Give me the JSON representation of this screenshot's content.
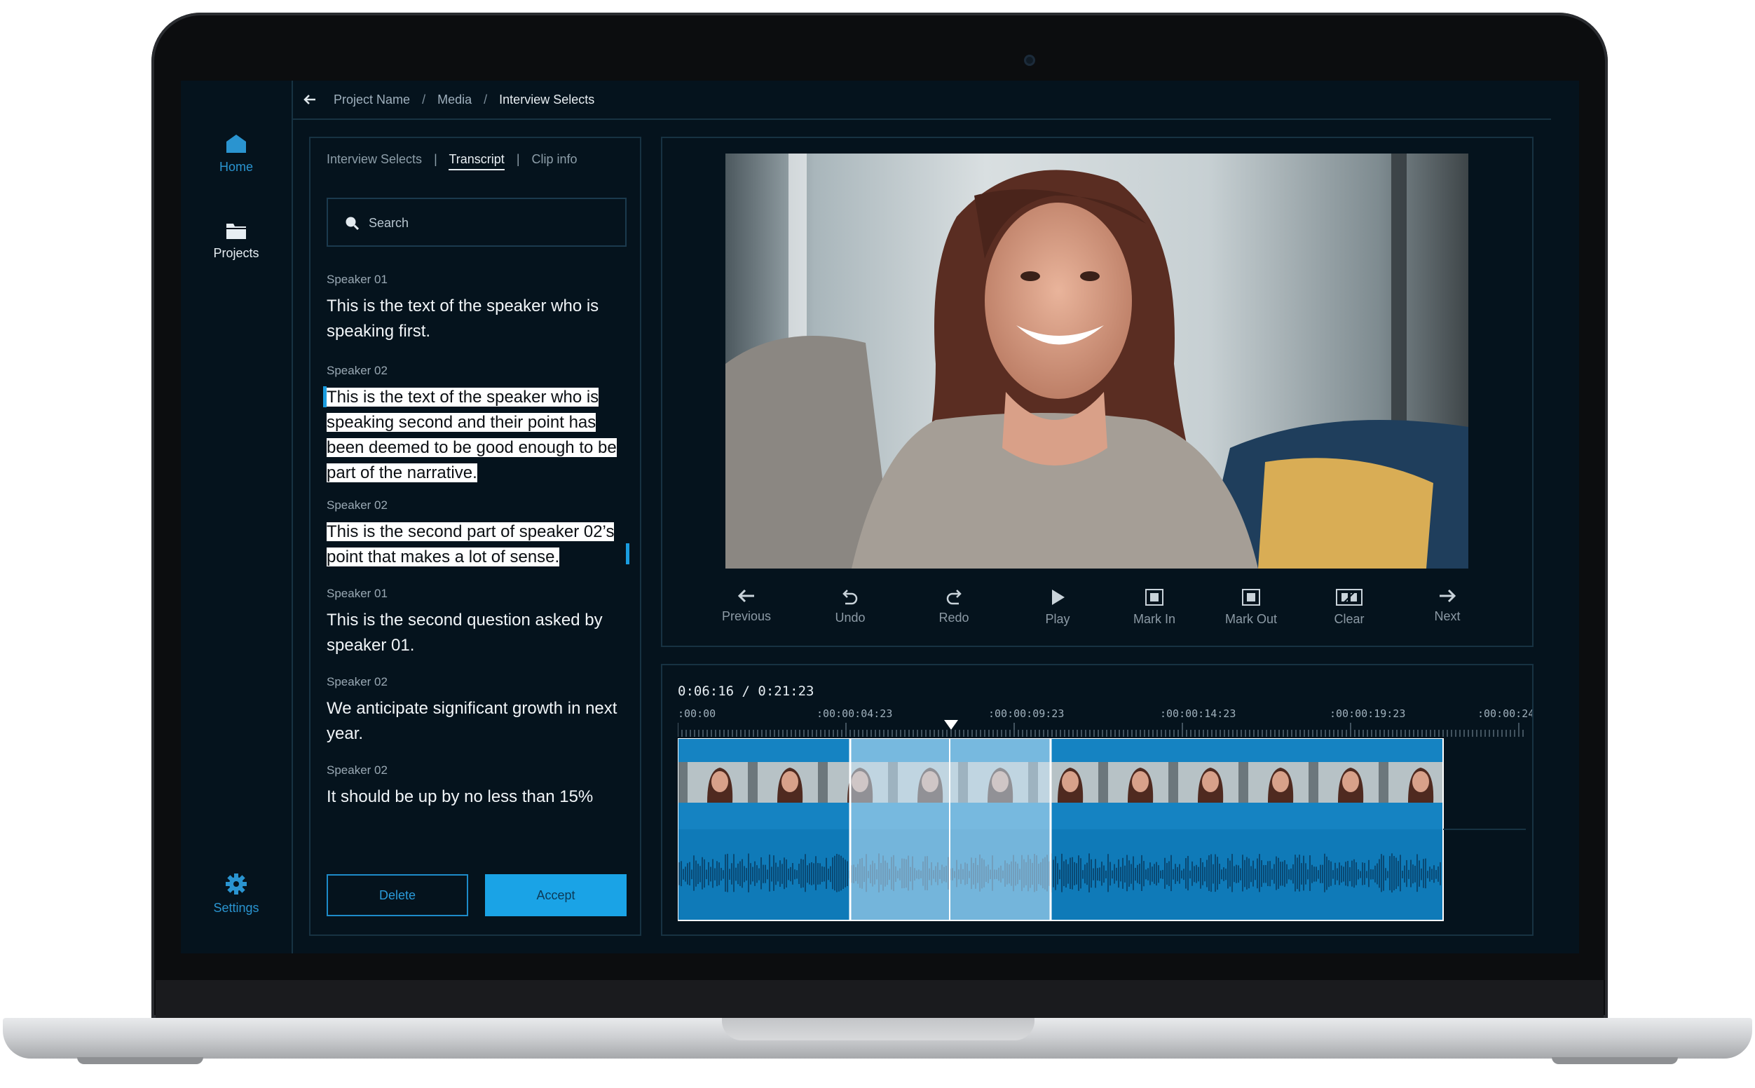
{
  "sidebar": {
    "home_label": "Home",
    "projects_label": "Projects",
    "settings_label": "Settings"
  },
  "breadcrumb": {
    "items": [
      "Project Name",
      "Media",
      "Interview Selects"
    ],
    "separator": "/"
  },
  "tabs": {
    "items": [
      "Interview Selects",
      "Transcript",
      "Clip info"
    ],
    "active": "Transcript",
    "separator": "|"
  },
  "search": {
    "placeholder": "Search"
  },
  "transcript": [
    {
      "speaker": "Speaker 01",
      "text": "This is the text of the speaker who is speaking first.",
      "highlighted": false
    },
    {
      "speaker": "Speaker 02",
      "text": "This is the text of the speaker who is speaking second and their point has been deemed to be good enough to be part of the narrative.",
      "highlighted": true
    },
    {
      "speaker": "Speaker 02",
      "text": "This is the second part of speaker 02’s point that makes a lot of sense.",
      "highlighted": true
    },
    {
      "speaker": "Speaker 01",
      "text": "This is the second question asked by speaker 01.",
      "highlighted": false
    },
    {
      "speaker": "Speaker 02",
      "text": "We anticipate significant growth in next year.",
      "highlighted": false
    },
    {
      "speaker": "Speaker 02",
      "text": "It should be up by no less than 15%",
      "highlighted": false
    }
  ],
  "actions": {
    "delete_label": "Delete",
    "accept_label": "Accept"
  },
  "controls": {
    "previous": "Previous",
    "undo": "Undo",
    "redo": "Redo",
    "play": "Play",
    "mark_in": "Mark In",
    "mark_out": "Mark Out",
    "clear": "Clear",
    "next": "Next"
  },
  "timeline": {
    "timecode": "0:06:16 / 0:21:23",
    "ticks": [
      ":00:00",
      ":00:00:04:23",
      ":00:00:09:23",
      ":00:00:14:23",
      ":00:00:19:23",
      ":00:00:24"
    ]
  },
  "colors": {
    "background": "#05131d",
    "accent": "#1aa3e6",
    "border": "#173242",
    "highlight": "#ffffff"
  }
}
